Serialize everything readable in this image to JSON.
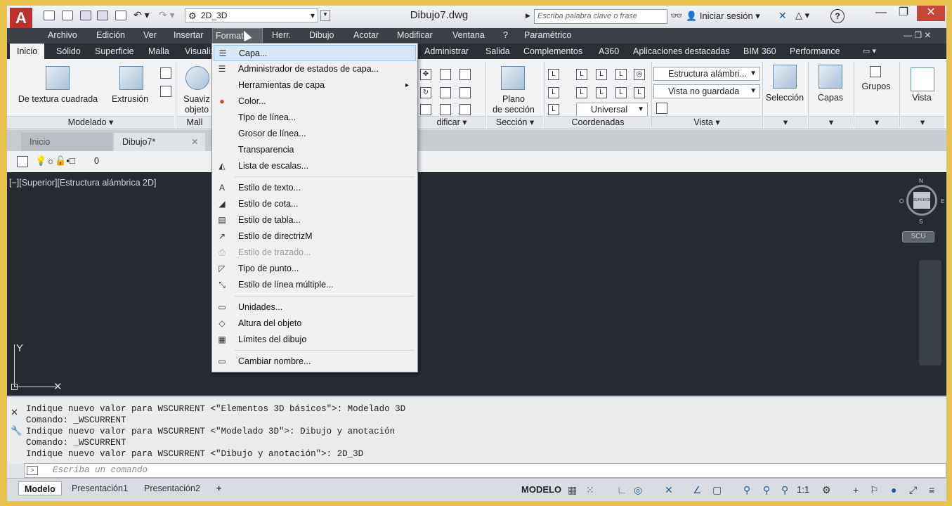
{
  "title_bar": {
    "workspace": "2D_3D",
    "doc_title": "Dibujo7.dwg",
    "search_placeholder": "Escriba palabra clave o frase",
    "login": "Iniciar sesión",
    "help": "?"
  },
  "menubar": [
    "Archivo",
    "Edición",
    "Ver",
    "Insertar",
    "Formato",
    "Herr.",
    "Dibujo",
    "Acotar",
    "Modificar",
    "Ventana",
    "?",
    "Paramétrico"
  ],
  "ribbon_tabs": [
    "Inicio",
    "Sólido",
    "Superficie",
    "Malla",
    "Visualiz",
    "Administrar",
    "Salida",
    "Complementos",
    "A360",
    "Aplicaciones destacadas",
    "BIM 360",
    "Performance"
  ],
  "ribbon": {
    "modelado": {
      "b1": "De textura cuadrada",
      "b2": "Extrusión",
      "footer": "Modelado ▾"
    },
    "malla": {
      "b1a": "Suaviz",
      "b1b": "objeto",
      "footer": "Mall"
    },
    "modificar_footer": "dificar ▾",
    "seccion": {
      "b1a": "Plano",
      "b1b": "de sección",
      "footer": "Sección ▾"
    },
    "coordenadas": {
      "sel": "Universal",
      "footer": "Coordenadas"
    },
    "vista": {
      "sel1": "Estructura alámbri...",
      "sel2": "Vista no guardada",
      "footer": "Vista ▾"
    },
    "seleccion": "Selección",
    "capas": "Capas",
    "grupos": "Grupos",
    "vista_btn": "Vista"
  },
  "doc_tabs": {
    "t1": "Inicio",
    "t2": "Dibujo7*"
  },
  "layer_value": "0",
  "canvas": {
    "view_label": "[−][Superior][Estructura alámbrica 2D]",
    "cube_n": "N",
    "cube_s": "S",
    "cube_e": "E",
    "cube_o": "O",
    "cube_face": "SUPERIOR",
    "scu": "SCU",
    "axis_y": "Y"
  },
  "command_history": [
    "Indique nuevo valor para WSCURRENT <\"Elementos 3D básicos\">: Modelado 3D",
    "Comando: _WSCURRENT",
    "Indique nuevo valor para WSCURRENT <\"Modelado 3D\">: Dibujo y anotación",
    "Comando: _WSCURRENT",
    "Indique nuevo valor para WSCURRENT <\"Dibujo y anotación\">: 2D_3D"
  ],
  "command_placeholder": "Escriba un comando",
  "layout_tabs": [
    "Modelo",
    "Presentación1",
    "Presentación2"
  ],
  "status": {
    "model": "MODELO",
    "scale": "1:1"
  },
  "format_menu": [
    {
      "label": "Capa...",
      "icon": "layers-icon"
    },
    {
      "label": "Administrador de estados de capa...",
      "icon": "layer-states-icon"
    },
    {
      "label": "Herramientas de capa",
      "icon": "",
      "submenu": "▸"
    },
    {
      "label": "Color...",
      "icon": "color-wheel-icon"
    },
    {
      "label": "Tipo de línea...",
      "icon": ""
    },
    {
      "label": "Grosor de línea...",
      "icon": ""
    },
    {
      "label": "Transparencia",
      "icon": ""
    },
    {
      "label": "Lista de escalas...",
      "icon": "scale-list-icon"
    },
    {
      "label": "Estilo de texto...",
      "icon": "text-style-icon"
    },
    {
      "label": "Estilo de cota...",
      "icon": "dim-style-icon"
    },
    {
      "label": "Estilo de tabla...",
      "icon": "table-style-icon"
    },
    {
      "label": "Estilo de directrizM",
      "icon": "mleader-style-icon"
    },
    {
      "label": "Estilo de trazado...",
      "icon": "plot-style-icon"
    },
    {
      "label": "Tipo de punto...",
      "icon": "point-style-icon"
    },
    {
      "label": "Estilo de línea múltiple...",
      "icon": "mline-style-icon"
    },
    {
      "label": "Unidades...",
      "icon": "units-icon"
    },
    {
      "label": "Altura del objeto",
      "icon": "thickness-icon"
    },
    {
      "label": "Límites del dibujo",
      "icon": "limits-icon"
    },
    {
      "label": "Cambiar nombre...",
      "icon": "rename-icon"
    }
  ]
}
